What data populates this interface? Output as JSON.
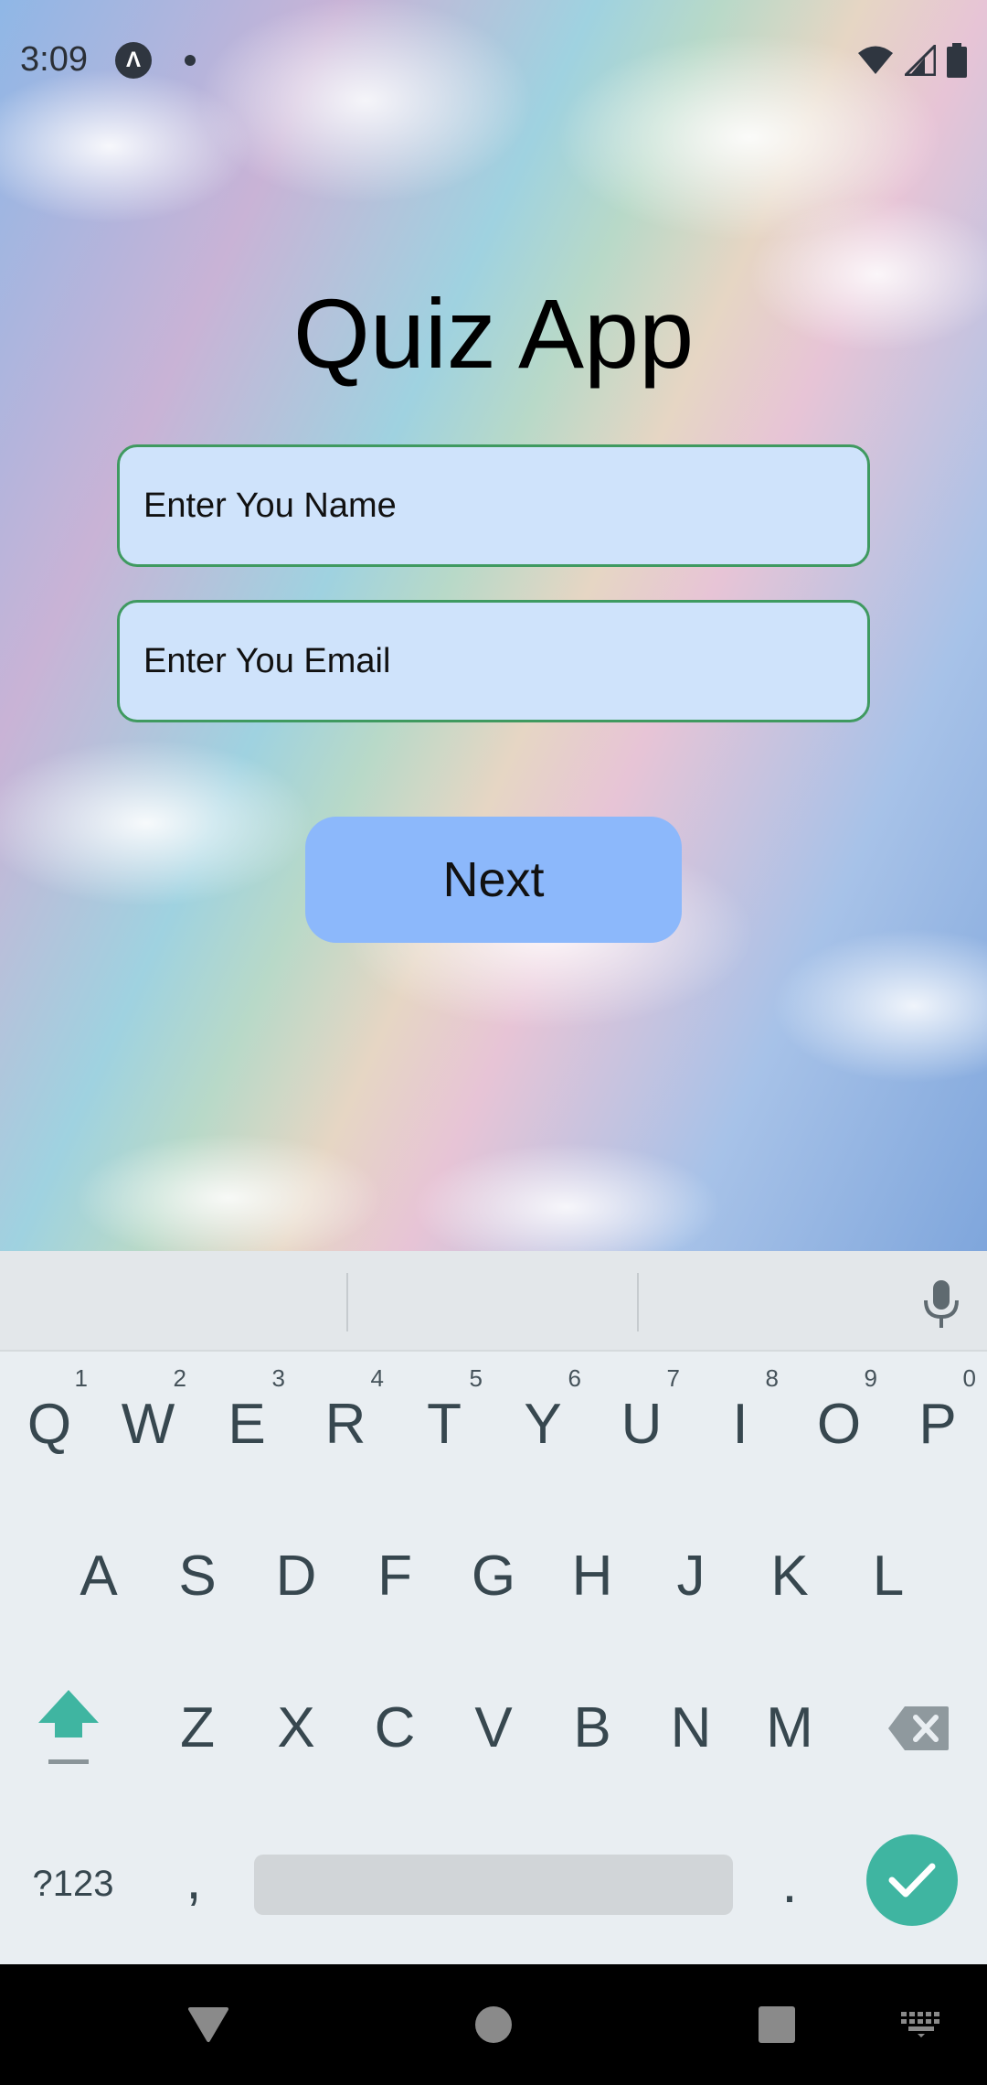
{
  "status_bar": {
    "time": "3:09",
    "notification_icon_glyph": "Λ",
    "icons": [
      "app-notification-icon",
      "dot-icon",
      "wifi-icon",
      "cell-signal-icon",
      "battery-icon"
    ]
  },
  "app": {
    "title": "Quiz App",
    "name_field": {
      "placeholder": "Enter You Name",
      "value": ""
    },
    "email_field": {
      "placeholder": "Enter You Email",
      "value": ""
    },
    "next_label": "Next"
  },
  "keyboard": {
    "row1": [
      {
        "label": "Q",
        "hint": "1"
      },
      {
        "label": "W",
        "hint": "2"
      },
      {
        "label": "E",
        "hint": "3"
      },
      {
        "label": "R",
        "hint": "4"
      },
      {
        "label": "T",
        "hint": "5"
      },
      {
        "label": "Y",
        "hint": "6"
      },
      {
        "label": "U",
        "hint": "7"
      },
      {
        "label": "I",
        "hint": "8"
      },
      {
        "label": "O",
        "hint": "9"
      },
      {
        "label": "P",
        "hint": "0"
      }
    ],
    "row2": [
      "A",
      "S",
      "D",
      "F",
      "G",
      "H",
      "J",
      "K",
      "L"
    ],
    "row3": [
      "Z",
      "X",
      "C",
      "V",
      "B",
      "N",
      "M"
    ],
    "symbols_label": "?123",
    "comma_label": ",",
    "period_label": "."
  },
  "colors": {
    "field_background": "#cfe3fb",
    "field_border": "#3f9a60",
    "button_background": "#8cb8fb",
    "keyboard_accent": "#3fb5a1",
    "keyboard_background": "#e9eef2"
  },
  "nav_bar": {
    "icons": [
      "back-icon",
      "home-icon",
      "recents-icon",
      "keyboard-switch-icon"
    ]
  }
}
